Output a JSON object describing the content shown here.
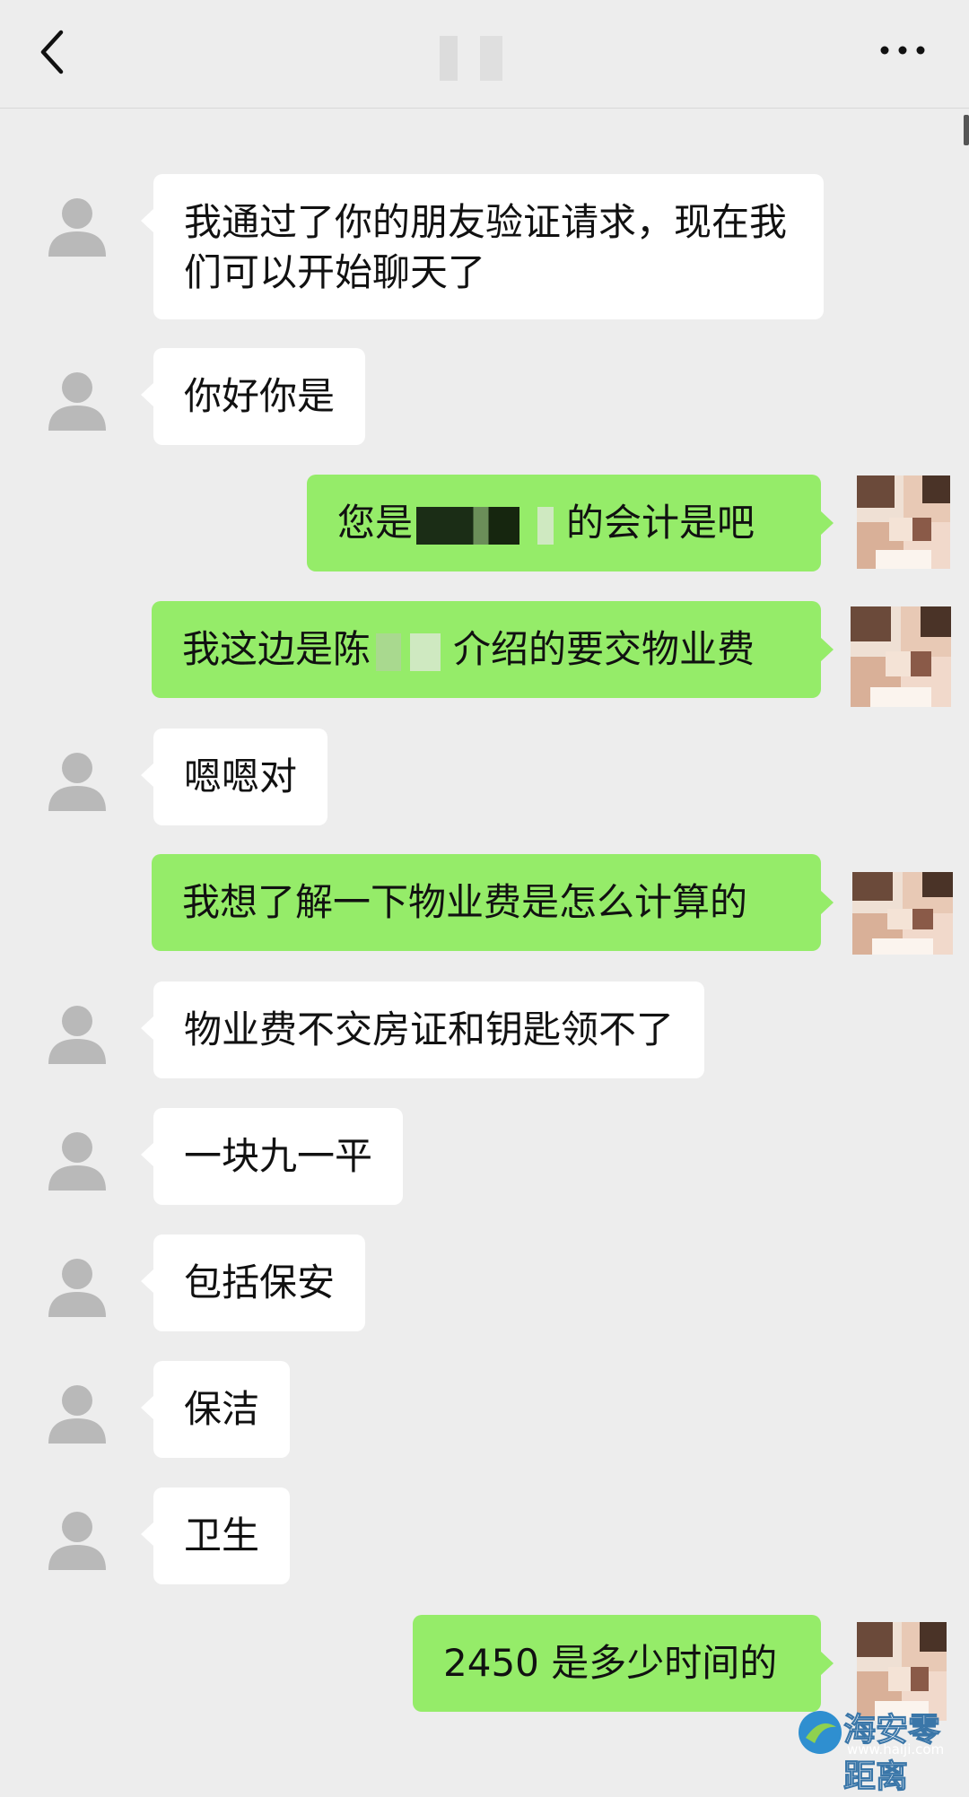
{
  "header": {
    "back_icon": "chevron-left-icon",
    "more_icon": "more-dots-icon"
  },
  "messages": [
    {
      "side": "in",
      "text": "我通过了你的朋友验证请求，现在我们可以开始聊天了"
    },
    {
      "side": "in",
      "text": "你好你是"
    },
    {
      "side": "out",
      "text_before": "您是",
      "text_after": "的会计是吧"
    },
    {
      "side": "out",
      "text_before": "我这边是陈",
      "text_after": "介绍的要交物业费"
    },
    {
      "side": "in",
      "text": "嗯嗯对"
    },
    {
      "side": "out",
      "text": "我想了解一下物业费是怎么计算的"
    },
    {
      "side": "in",
      "text": "物业费不交房证和钥匙领不了"
    },
    {
      "side": "in",
      "text": "一块九一平"
    },
    {
      "side": "in",
      "text": "包括保安"
    },
    {
      "side": "in",
      "text": "保洁"
    },
    {
      "side": "in",
      "text": "卫生"
    },
    {
      "side": "out",
      "text": "2450 是多少时间的"
    }
  ],
  "watermark": {
    "text": "海安零距离",
    "url": "www.haiji.com"
  },
  "colors": {
    "background": "#ededed",
    "incoming_bubble": "#ffffff",
    "outgoing_bubble": "#95ec69"
  }
}
